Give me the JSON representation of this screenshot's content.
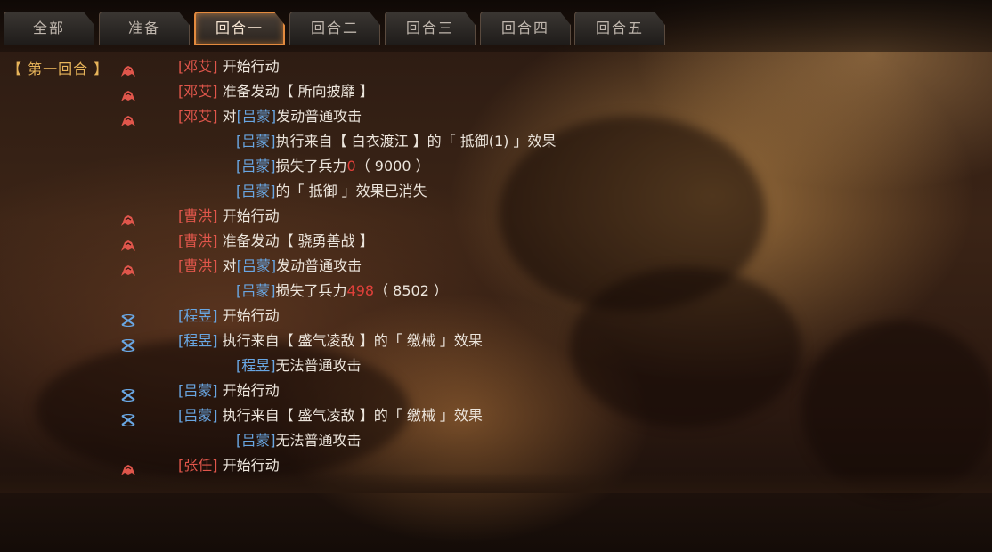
{
  "tabs": [
    {
      "label": "全部",
      "active": false
    },
    {
      "label": "准备",
      "active": false
    },
    {
      "label": "回合一",
      "active": true
    },
    {
      "label": "回合二",
      "active": false
    },
    {
      "label": "回合三",
      "active": false
    },
    {
      "label": "回合四",
      "active": false
    },
    {
      "label": "回合五",
      "active": false
    }
  ],
  "round_label": "【 第一回合 】",
  "colors": {
    "red_team": "#e0564b",
    "blue_team": "#69a6e2",
    "round_label": "#e7b45a",
    "active_tab_border": "#e38a3e"
  },
  "log": [
    {
      "icon": "red-horse-icon",
      "segments": [
        {
          "t": "[邓艾]",
          "c": "red"
        },
        {
          "t": " 开始行动",
          "c": "dim"
        }
      ]
    },
    {
      "icon": "red-horse-icon",
      "segments": [
        {
          "t": "[邓艾]",
          "c": "red"
        },
        {
          "t": " 准备发动【 所向披靡 】",
          "c": "dim"
        }
      ]
    },
    {
      "icon": "red-horse-icon",
      "segments": [
        {
          "t": "[邓艾]",
          "c": "red"
        },
        {
          "t": " 对",
          "c": "dim"
        },
        {
          "t": "[吕蒙]",
          "c": "blue"
        },
        {
          "t": "发动普通攻击",
          "c": "dim"
        }
      ]
    },
    {
      "sub": true,
      "segments": [
        {
          "t": "[吕蒙]",
          "c": "blue"
        },
        {
          "t": "执行来自【 白衣渡江 】的「 抵御(1) 」效果",
          "c": "dim"
        }
      ]
    },
    {
      "sub": true,
      "segments": [
        {
          "t": "[吕蒙]",
          "c": "blue"
        },
        {
          "t": "损失了兵力",
          "c": "dim"
        },
        {
          "t": "0",
          "c": "num-red"
        },
        {
          "t": "（ 9000 ）",
          "c": "dim"
        }
      ]
    },
    {
      "sub": true,
      "segments": [
        {
          "t": "[吕蒙]",
          "c": "blue"
        },
        {
          "t": "的「 抵御 」效果已消失",
          "c": "dim"
        }
      ]
    },
    {
      "icon": "red-horse-icon",
      "segments": [
        {
          "t": "[曹洪]",
          "c": "red"
        },
        {
          "t": " 开始行动",
          "c": "dim"
        }
      ]
    },
    {
      "icon": "red-horse-icon",
      "segments": [
        {
          "t": "[曹洪]",
          "c": "red"
        },
        {
          "t": " 准备发动【 骁勇善战 】",
          "c": "dim"
        }
      ]
    },
    {
      "icon": "red-horse-icon",
      "segments": [
        {
          "t": "[曹洪]",
          "c": "red"
        },
        {
          "t": " 对",
          "c": "dim"
        },
        {
          "t": "[吕蒙]",
          "c": "blue"
        },
        {
          "t": "发动普通攻击",
          "c": "dim"
        }
      ]
    },
    {
      "sub": true,
      "segments": [
        {
          "t": "[吕蒙]",
          "c": "blue"
        },
        {
          "t": "损失了兵力",
          "c": "dim"
        },
        {
          "t": "498",
          "c": "num-red"
        },
        {
          "t": "（ 8502 ）",
          "c": "dim"
        }
      ]
    },
    {
      "icon": "blue-bow-icon",
      "segments": [
        {
          "t": "[程昱]",
          "c": "blue"
        },
        {
          "t": " 开始行动",
          "c": "dim"
        }
      ]
    },
    {
      "icon": "blue-bow-icon",
      "segments": [
        {
          "t": "[程昱]",
          "c": "blue"
        },
        {
          "t": " 执行来自【 盛气凌敌 】的「 缴械 」效果",
          "c": "dim"
        }
      ]
    },
    {
      "sub": true,
      "segments": [
        {
          "t": "[程昱]",
          "c": "blue"
        },
        {
          "t": "无法普通攻击",
          "c": "dim"
        }
      ]
    },
    {
      "icon": "blue-bow-icon",
      "segments": [
        {
          "t": "[吕蒙]",
          "c": "blue"
        },
        {
          "t": " 开始行动",
          "c": "dim"
        }
      ]
    },
    {
      "icon": "blue-bow-icon",
      "segments": [
        {
          "t": "[吕蒙]",
          "c": "blue"
        },
        {
          "t": " 执行来自【 盛气凌敌 】的「 缴械 」效果",
          "c": "dim"
        }
      ]
    },
    {
      "sub": true,
      "segments": [
        {
          "t": "[吕蒙]",
          "c": "blue"
        },
        {
          "t": "无法普通攻击",
          "c": "dim"
        }
      ]
    },
    {
      "icon": "red-horse-icon",
      "segments": [
        {
          "t": "[张任]",
          "c": "red"
        },
        {
          "t": " 开始行动",
          "c": "dim"
        }
      ]
    }
  ]
}
